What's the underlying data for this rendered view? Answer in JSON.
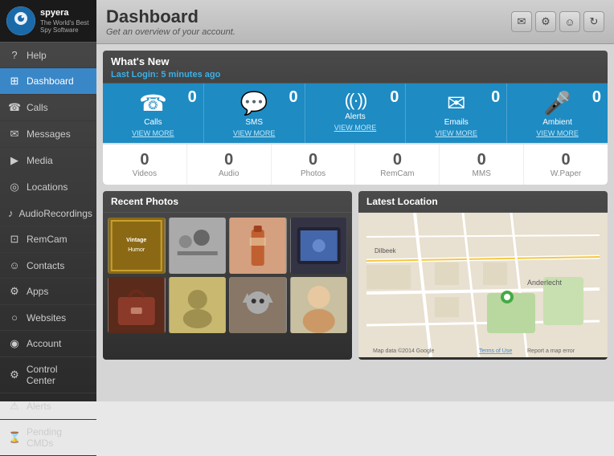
{
  "app": {
    "logo_text": "spyera",
    "logo_sub": "The World's Best Spy Software"
  },
  "sidebar": {
    "items": [
      {
        "id": "help",
        "label": "Help",
        "icon": "?"
      },
      {
        "id": "dashboard",
        "label": "Dashboard",
        "icon": "⊞",
        "active": true
      },
      {
        "id": "calls",
        "label": "Calls",
        "icon": "☎"
      },
      {
        "id": "messages",
        "label": "Messages",
        "icon": "✉"
      },
      {
        "id": "media",
        "label": "Media",
        "icon": "▶"
      },
      {
        "id": "locations",
        "label": "Locations",
        "icon": "◎"
      },
      {
        "id": "audio-recordings",
        "label": "AudioRecordings",
        "icon": "♪"
      },
      {
        "id": "remcam",
        "label": "RemCam",
        "icon": "📷"
      },
      {
        "id": "contacts",
        "label": "Contacts",
        "icon": "👤"
      },
      {
        "id": "apps",
        "label": "Apps",
        "icon": "⚙"
      },
      {
        "id": "websites",
        "label": "Websites",
        "icon": "🌐"
      },
      {
        "id": "account",
        "label": "Account",
        "icon": "👤"
      },
      {
        "id": "control-center",
        "label": "Control Center",
        "icon": "⚙"
      },
      {
        "id": "alerts",
        "label": "Alerts",
        "icon": "⚠"
      },
      {
        "id": "pending-cmds",
        "label": "Pending CMDs",
        "icon": "⏳"
      }
    ]
  },
  "header": {
    "title": "Dashboard",
    "subtitle": "Get an overview of your account."
  },
  "topbar_buttons": {
    "email": "✉",
    "settings": "⚙",
    "user": "👤",
    "refresh": "↻"
  },
  "whats_new": {
    "title": "What's New",
    "last_login_label": "Last Login:",
    "last_login_value": "5 minutes ago"
  },
  "metrics": [
    {
      "id": "calls",
      "icon": "☎",
      "count": "0",
      "label": "Calls",
      "link": "VIEW MORE"
    },
    {
      "id": "sms",
      "icon": "💬",
      "count": "0",
      "label": "SMS",
      "link": "VIEW MORE"
    },
    {
      "id": "alerts",
      "icon": "((·))",
      "count": "0",
      "label": "Alerts",
      "link": "VIEW MORE"
    },
    {
      "id": "emails",
      "icon": "✉",
      "count": "0",
      "label": "Emails",
      "link": "VIEW MORE"
    },
    {
      "id": "ambient",
      "icon": "🎤",
      "count": "0",
      "label": "Ambient",
      "link": "VIEW MORE"
    }
  ],
  "secondary_metrics": [
    {
      "id": "videos",
      "count": "0",
      "label": "Videos"
    },
    {
      "id": "audio",
      "count": "0",
      "label": "Audio"
    },
    {
      "id": "photos",
      "count": "0",
      "label": "Photos"
    },
    {
      "id": "remcam",
      "count": "0",
      "label": "RemCam"
    },
    {
      "id": "mms",
      "count": "0",
      "label": "MMS"
    },
    {
      "id": "wpaper",
      "count": "0",
      "label": "W.Paper"
    }
  ],
  "recent_photos": {
    "title": "Recent Photos",
    "photos": [
      {
        "id": "p1",
        "color": "#8B6914",
        "label": "Vintage"
      },
      {
        "id": "p2",
        "color": "#888",
        "label": ""
      },
      {
        "id": "p3",
        "color": "#c06030",
        "label": ""
      },
      {
        "id": "p4",
        "color": "#4466aa",
        "label": ""
      },
      {
        "id": "p5",
        "color": "#6b3a2a",
        "label": ""
      },
      {
        "id": "p6",
        "color": "#b8a060",
        "label": ""
      },
      {
        "id": "p7",
        "color": "#887766",
        "label": ""
      },
      {
        "id": "p8",
        "color": "#ddddcc",
        "label": ""
      }
    ]
  },
  "latest_location": {
    "title": "Latest Location",
    "place": "Anderlecht",
    "map_credit": "Map data ©2014 Google"
  },
  "colors": {
    "sidebar_bg": "#333",
    "active_item": "#3a87c8",
    "metric_bg": "#1e8bc3",
    "header_bg": "#cccccc"
  }
}
